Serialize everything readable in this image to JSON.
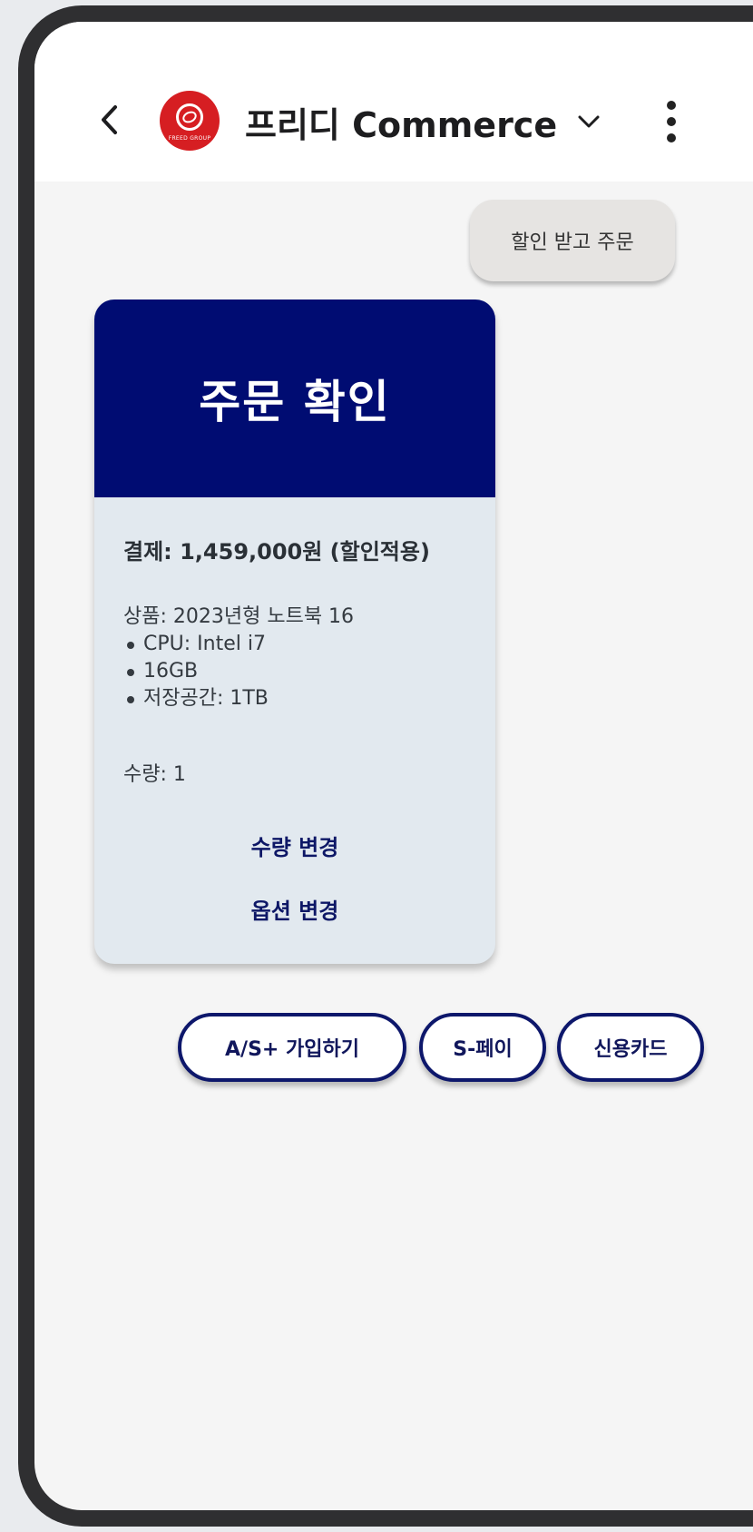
{
  "app": {
    "title": "프리디 Commerce",
    "logo_text": "FREED GROUP"
  },
  "chat": {
    "user_message": "할인 받고 주문"
  },
  "order_card": {
    "title": "주문 확인",
    "payment": "결제: 1,459,000원 (할인적용)",
    "product": "상품: 2023년형 노트북 16",
    "specs": [
      "CPU: Intel i7",
      "16GB",
      "저장공간: 1TB"
    ],
    "quantity": "수량: 1",
    "actions": {
      "change_quantity": "수량 변경",
      "change_option": "옵션 변경"
    }
  },
  "quick_replies": [
    "A/S+ 가입하기",
    "S-페이",
    "신용카드"
  ],
  "colors": {
    "header_navy": "#000c72",
    "card_bg": "#e2e9ef",
    "chip_border": "#0d176b",
    "logo_red": "#d61e22"
  }
}
